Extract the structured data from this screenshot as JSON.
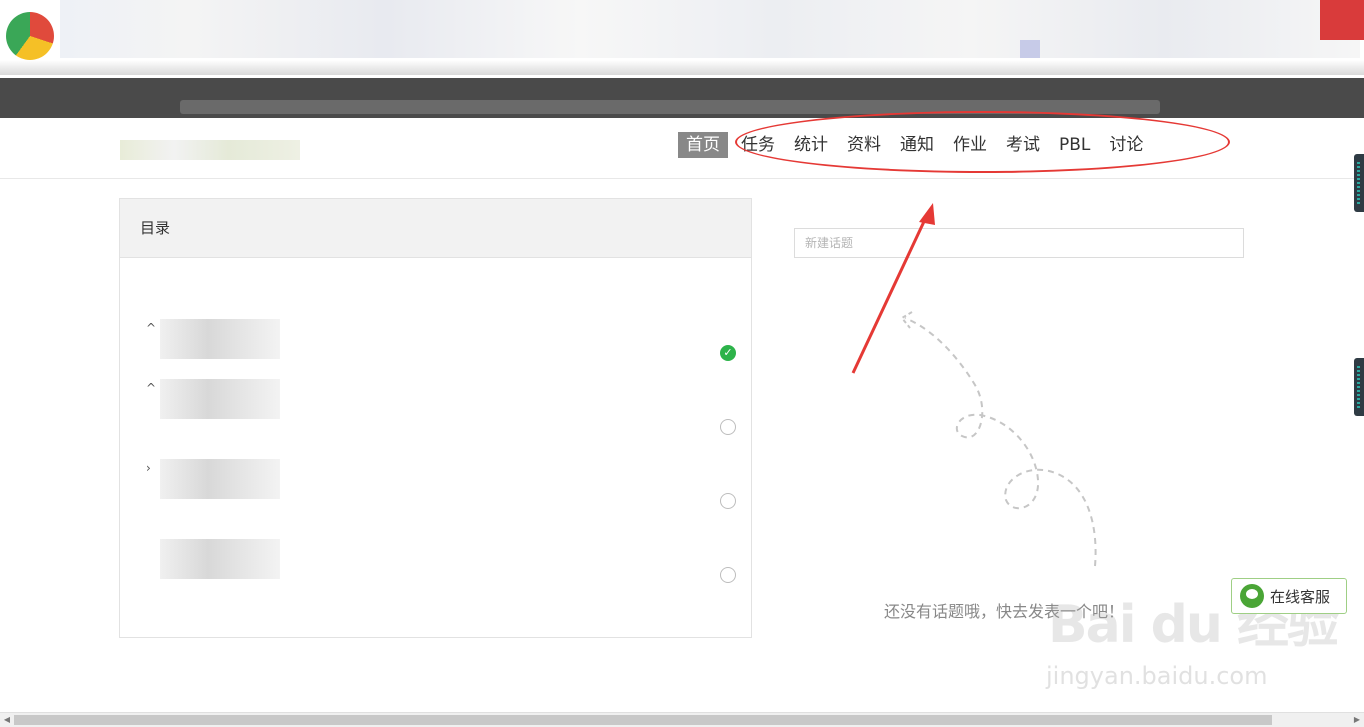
{
  "header": {
    "nav": [
      "首页",
      "任务",
      "统计",
      "资料",
      "通知",
      "作业",
      "考试",
      "PBL",
      "讨论"
    ],
    "active_nav": "首页"
  },
  "catalog": {
    "title": "目录",
    "chapters": [
      {
        "status": "done"
      },
      {
        "status": "todo"
      },
      {
        "status": "todo"
      },
      {
        "status": "todo"
      }
    ]
  },
  "discussion": {
    "new_topic_placeholder": "新建话题",
    "empty_message": "还没有话题哦，快去发表一个吧！"
  },
  "service": {
    "label": "在线客服"
  },
  "watermark": {
    "logo": "Bai du 经验",
    "url": "jingyan.baidu.com"
  },
  "colors": {
    "active_nav_bg": "#888888",
    "annotation_red": "#e53935",
    "done_green": "#2db34a"
  }
}
